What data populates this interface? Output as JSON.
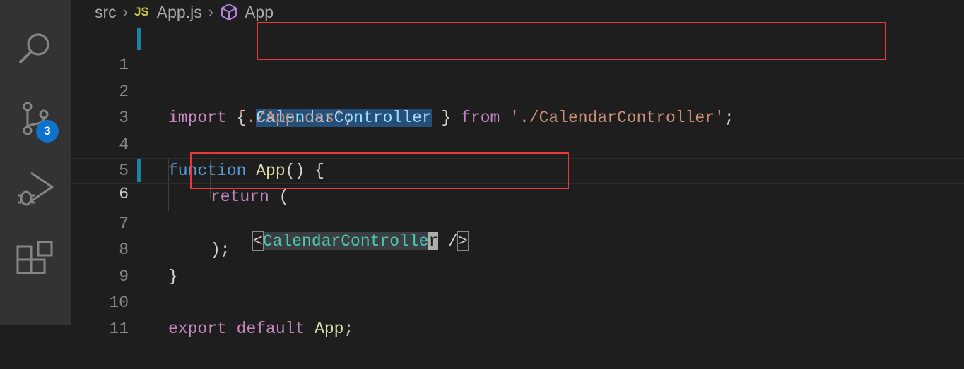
{
  "activity_bar": {
    "icons": [
      "search-icon",
      "source-control-icon",
      "run-debug-icon",
      "extensions-icon"
    ],
    "source_control_badge": "3"
  },
  "breadcrumb": {
    "folder": "src",
    "file_icon": "JS",
    "file": "App.js",
    "symbol": "App"
  },
  "editor": {
    "line_numbers": [
      "1",
      "2",
      "3",
      "4",
      "5",
      "6",
      "7",
      "8",
      "9",
      "10",
      "11"
    ],
    "active_line": "6",
    "tokens": {
      "l1_import": "import",
      "l1_open": " { ",
      "l1_name": "CalendarController",
      "l1_close": " } ",
      "l1_from": "from",
      "l1_space": " ",
      "l1_path": "'./CalendarController'",
      "l1_semi": ";",
      "l2_import": "import",
      "l2_space": " ",
      "l2_path": "'./App.css'",
      "l2_semi": ";",
      "l4_function": "function",
      "l4_space": " ",
      "l4_name": "App",
      "l4_rest": "() {",
      "l5_return": "return",
      "l5_rest": " (",
      "l6_lt": "<",
      "l6_tag_a": "CalendarControlle",
      "l6_tag_b": "r",
      "l6_slash": " /",
      "l6_gt": ">",
      "l7": ");",
      "l8": "}",
      "l10_export": "export",
      "l10_space1": " ",
      "l10_default": "default",
      "l10_space2": " ",
      "l10_name": "App",
      "l10_semi": ";"
    }
  },
  "colors": {
    "highlight_box": "#e5393b",
    "badge": "#0e73cc",
    "keyword": "#c586c0",
    "string": "#ce9178",
    "component": "#4ec9b0"
  }
}
